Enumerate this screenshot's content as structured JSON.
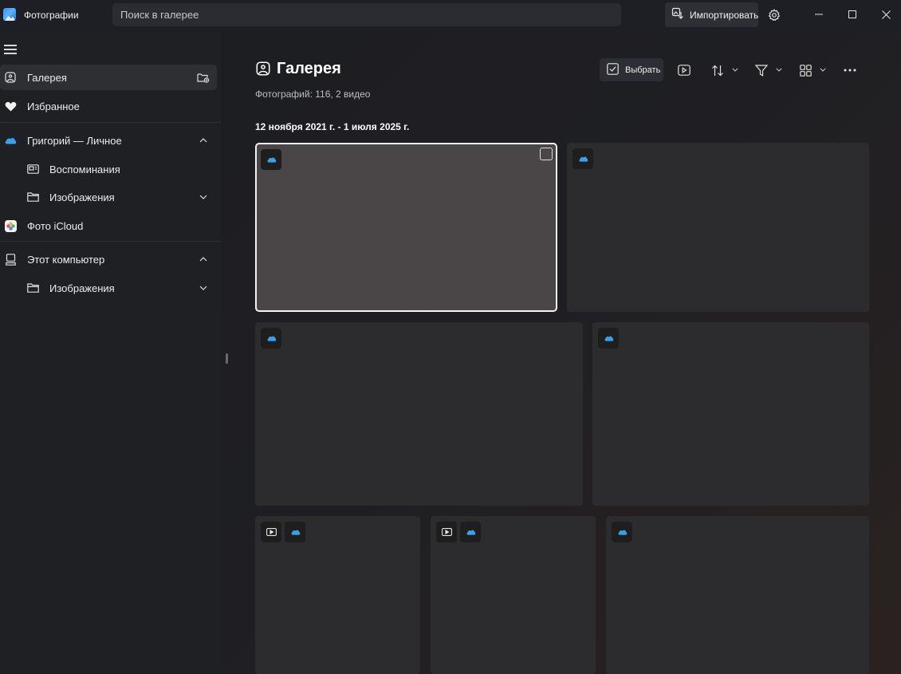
{
  "app": {
    "title": "Фотографии"
  },
  "search": {
    "placeholder": "Поиск в галерее"
  },
  "titlebar": {
    "import_label": "Импортировать"
  },
  "sidebar": {
    "items": [
      {
        "label": "Галерея",
        "icon": "gallery-icon",
        "active": true
      },
      {
        "label": "Избранное",
        "icon": "heart-icon"
      },
      {
        "label": "Григорий — Личное",
        "icon": "onedrive-cloud-icon",
        "expanded": true
      },
      {
        "label": "Воспоминания",
        "icon": "memories-icon"
      },
      {
        "label": "Изображения",
        "icon": "folder-icon",
        "expanded": false
      },
      {
        "label": "Фото iCloud",
        "icon": "icloud-photos-icon"
      },
      {
        "label": "Этот компьютер",
        "icon": "computer-icon",
        "expanded": true
      },
      {
        "label": "Изображения",
        "icon": "folder-icon",
        "expanded": false
      }
    ]
  },
  "main": {
    "title": "Галерея",
    "subtitle": "Фотографий: 116, 2 видео",
    "date_range": "12 ноября 2021 г. - 1 июля 2025 г."
  },
  "toolbar": {
    "select_label": "Выбрать"
  },
  "tiles": [
    {
      "badges": [
        "onedrive"
      ],
      "selected": true
    },
    {
      "badges": [
        "onedrive"
      ]
    },
    {
      "badges": [
        "onedrive"
      ]
    },
    {
      "badges": [
        "onedrive"
      ]
    },
    {
      "badges": [
        "video",
        "onedrive"
      ]
    },
    {
      "badges": [
        "video",
        "onedrive"
      ]
    },
    {
      "badges": [
        "onedrive"
      ]
    }
  ],
  "colors": {
    "accent_cloud": "#3ba0ea",
    "background": "#1f2024",
    "tile": "#2c2c2e",
    "tile_selected": "#4a4546"
  }
}
